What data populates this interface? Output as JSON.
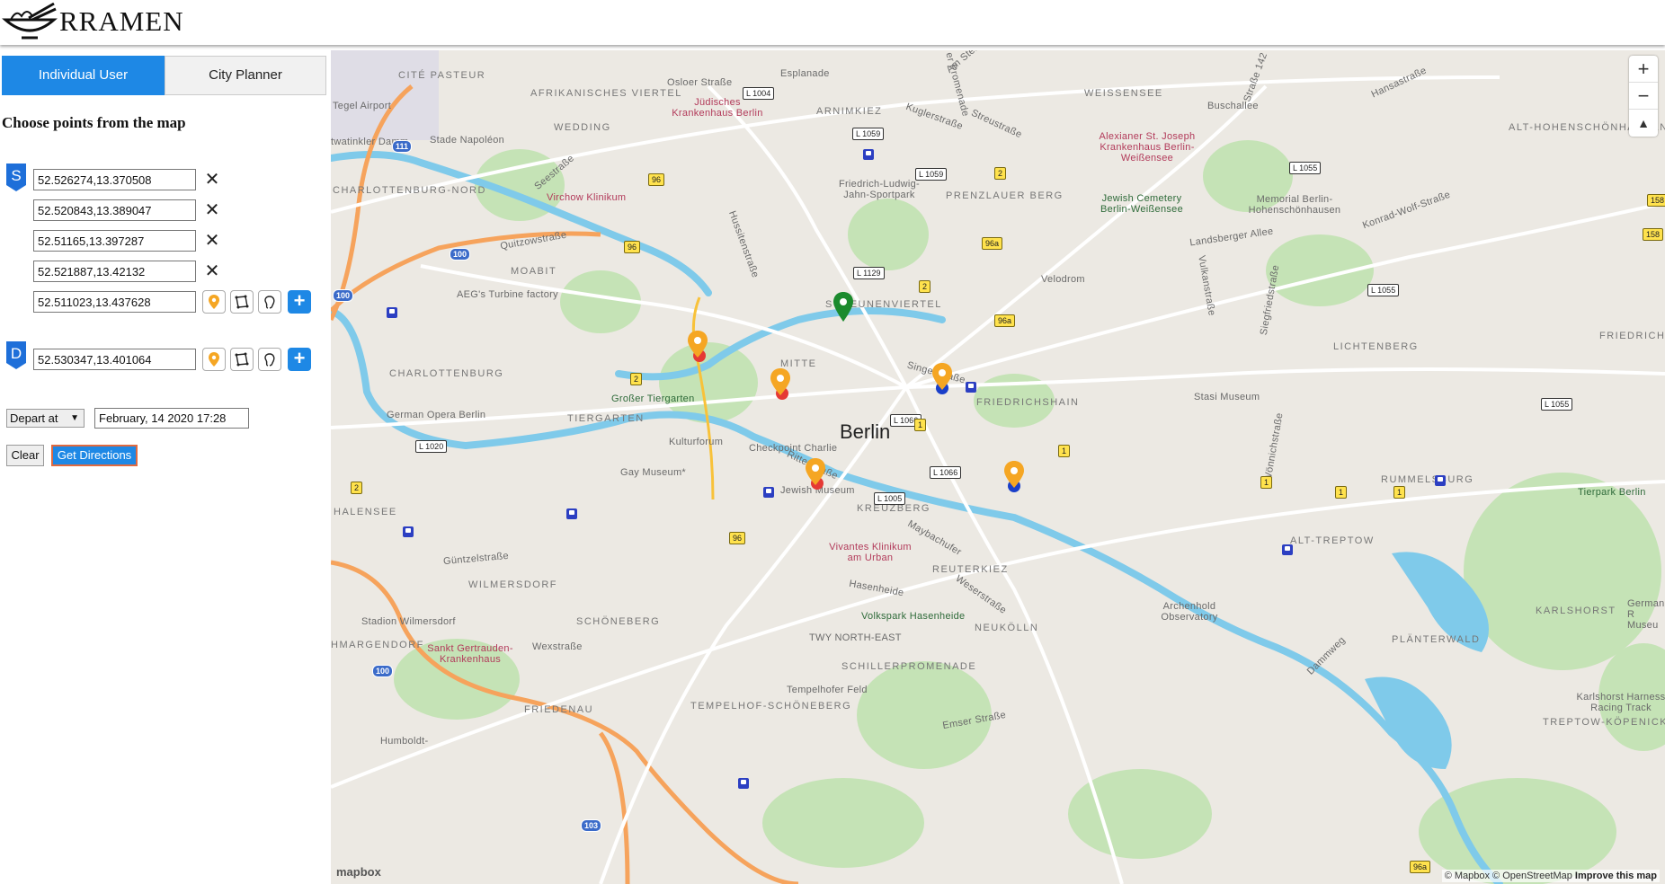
{
  "header": {
    "title": "RRAMEN",
    "logo_icon": "ramen-bowl-icon"
  },
  "tabs": [
    {
      "label": "Individual User",
      "active": true
    },
    {
      "label": "City Planner",
      "active": false
    }
  ],
  "heading": "Choose points from the map",
  "source": {
    "badge": "S",
    "points": [
      "52.526274,13.370508",
      "52.520843,13.389047",
      "52.51165,13.397287",
      "52.521887,13.42132",
      "52.511023,13.437628"
    ]
  },
  "destination": {
    "badge": "D",
    "point": "52.530347,13.401064"
  },
  "remove_glyph": "✕",
  "add_glyph": "+",
  "depart": {
    "selected": "Depart at",
    "datetime": "February, 14 2020 17:28"
  },
  "buttons": {
    "clear": "Clear",
    "get_directions": "Get Directions"
  },
  "colors": {
    "accent": "#1e88e5",
    "marker_orange": "#f5a623",
    "marker_red": "#e53935",
    "marker_blue": "#1a3fc9",
    "marker_green": "#1b8a2d"
  },
  "map": {
    "city": "Berlin",
    "zoom_in": "+",
    "zoom_out": "−",
    "compass": "▲",
    "attribution": "© Mapbox © OpenStreetMap",
    "improve": "Improve this map",
    "mapbox_logo": "mapbox",
    "districts": [
      "CITÉ PASTEUR",
      "AFRIKANISCHES VIERTEL",
      "WEDDING",
      "ARNIMKIEZ",
      "WEISSENSEE",
      "ALT-HOHENSCHÖNHAUSEN",
      "PRENZLAUER BERG",
      "CHARLOTTENBURG-NORD",
      "MOABIT",
      "SCHEUNENVIERTEL",
      "MITTE",
      "CHARLOTTENBURG",
      "TIERGARTEN",
      "FRIEDRICHSHAIN",
      "LICHTENBERG",
      "FRIEDRICHSFELDE OST",
      "HALENSEE",
      "KREUZBERG",
      "RUMMELSBURG",
      "ALT-TREPTOW",
      "WILMERSDORF",
      "REUTERKIEZ",
      "SCHÖNEBERG",
      "NEUKÖLLN",
      "KARLSHORST",
      "PLÄNTERWALD",
      "SCHILLERPROMENADE",
      "FRIEDENAU",
      "TEMPELHOF-SCHÖNEBERG",
      "HMARGENDORF",
      "TREPTOW-KÖPENICK"
    ],
    "places": [
      "Tegel Airport",
      "Stade Napoléon",
      "Jüdisches Krankenhaus Berlin",
      "Virchow Klinikum",
      "Friedrich-Ludwig-Jahn-Sportpark",
      "Alexianer St. Joseph Krankenhaus Berlin-Weißensee",
      "Jewish Cemetery Berlin-Weißensee",
      "Memorial Berlin-Hohenschönhausen",
      "Velodrom",
      "AEG's Turbine factory",
      "Großer Tiergarten",
      "German Opera Berlin",
      "Kulturforum",
      "Checkpoint Charlie",
      "Stasi Museum",
      "Gay Museum*",
      "Jewish Museum",
      "Tierpark Berlin",
      "Vivantes Klinikum am Urban",
      "Volkspark Hasenheide",
      "Archenhold Observatory",
      "Stadion Wilmersdorf",
      "Sankt Gertrauden-Krankenhaus",
      "Tempelhofer Feld",
      "Karlshorst Harness Racing Track",
      "TWY NORTH-EAST",
      "Humboldt-",
      "German-R Museu"
    ],
    "streets": [
      "Osloer Straße",
      "Seestraße",
      "Quitzowstraße",
      "Esplanade",
      "Kuglerstraße",
      "Streustraße",
      "Buschallee",
      "Hansastraße",
      "Konrad-Wolf-Straße",
      "Landsberger Allee",
      "Singerstraße",
      "Ritterstraße",
      "Hasenheide",
      "Weserstraße",
      "Maybachufer",
      "Güntzelstraße",
      "Wexstraße",
      "Emser Straße",
      "Dammweg",
      "Hussitenstraße",
      "Vulkanstraße",
      "Siegfriedstraße",
      "Wönnichstraße",
      "twatinkler Damm",
      "er Promenade",
      "Am Steinb",
      "Straße 142"
    ],
    "road_shields": [
      "L 1004",
      "L 1059",
      "L 1059",
      "L 1055",
      "158",
      "158",
      "L 1129",
      "L 1055",
      "L 1066",
      "L 1066",
      "L 1005",
      "L 1020",
      "L 1055",
      "96",
      "96",
      "96",
      "96a",
      "96a",
      "96a",
      "2",
      "2",
      "2",
      "2",
      "1",
      "1",
      "1",
      "1",
      "1",
      "100",
      "100",
      "100",
      "103",
      "111"
    ]
  }
}
